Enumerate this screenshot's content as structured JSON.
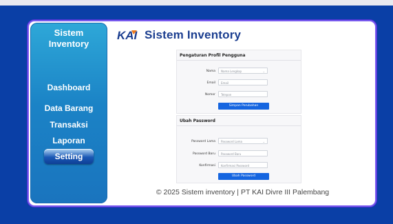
{
  "sidebar": {
    "brand_line1": "Sistem",
    "brand_line2": "Inventory",
    "items": [
      {
        "label": "Dashboard"
      },
      {
        "label": "Data Barang"
      },
      {
        "label": "Transaksi"
      },
      {
        "label": "Laporan"
      },
      {
        "label": "Setting",
        "active": true
      }
    ]
  },
  "header": {
    "logo_text": "KAI",
    "title": "Sistem Inventory"
  },
  "profile_form": {
    "title": "Pengaturan Profil Pengguna",
    "fields": [
      {
        "label": "Nama",
        "placeholder": "Nama Lengkap"
      },
      {
        "label": "Email",
        "placeholder": "Email"
      },
      {
        "label": "Nomor",
        "placeholder": "Telepon"
      }
    ],
    "submit_label": "Simpan Perubahan"
  },
  "password_form": {
    "title": "Ubah Password",
    "fields": [
      {
        "label": "Password Lama",
        "placeholder": "Password Lama"
      },
      {
        "label": "Password Baru",
        "placeholder": "Password Baru"
      },
      {
        "label": "Konfirmasi",
        "placeholder": "Konfirmasi Password"
      }
    ],
    "submit_label": "Ubah Password"
  },
  "footer": {
    "text": "© 2025 Sistem inventory | PT KAI Divre III Palembang"
  },
  "colors": {
    "background": "#0a3fa6",
    "sidebar": "#1b83c6",
    "title": "#1a3d8f",
    "button": "#1565e0",
    "frame_border": "#7b5cf0"
  }
}
